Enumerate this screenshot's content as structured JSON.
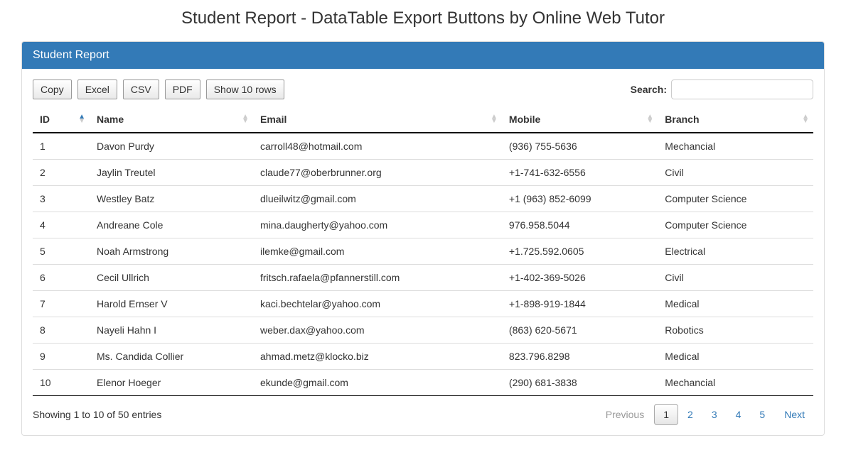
{
  "page_title": "Student Report - DataTable Export Buttons by Online Web Tutor",
  "panel_title": "Student Report",
  "toolbar": {
    "buttons": {
      "copy": "Copy",
      "excel": "Excel",
      "csv": "CSV",
      "pdf": "PDF",
      "show_rows": "Show 10 rows"
    },
    "search_label": "Search:",
    "search_value": ""
  },
  "columns": {
    "id": "ID",
    "name": "Name",
    "email": "Email",
    "mobile": "Mobile",
    "branch": "Branch"
  },
  "rows": [
    {
      "id": "1",
      "name": "Davon Purdy",
      "email": "carroll48@hotmail.com",
      "mobile": "(936) 755-5636",
      "branch": "Mechancial"
    },
    {
      "id": "2",
      "name": "Jaylin Treutel",
      "email": "claude77@oberbrunner.org",
      "mobile": "+1-741-632-6556",
      "branch": "Civil"
    },
    {
      "id": "3",
      "name": "Westley Batz",
      "email": "dlueilwitz@gmail.com",
      "mobile": "+1 (963) 852-6099",
      "branch": "Computer Science"
    },
    {
      "id": "4",
      "name": "Andreane Cole",
      "email": "mina.daugherty@yahoo.com",
      "mobile": "976.958.5044",
      "branch": "Computer Science"
    },
    {
      "id": "5",
      "name": "Noah Armstrong",
      "email": "ilemke@gmail.com",
      "mobile": "+1.725.592.0605",
      "branch": "Electrical"
    },
    {
      "id": "6",
      "name": "Cecil Ullrich",
      "email": "fritsch.rafaela@pfannerstill.com",
      "mobile": "+1-402-369-5026",
      "branch": "Civil"
    },
    {
      "id": "7",
      "name": "Harold Ernser V",
      "email": "kaci.bechtelar@yahoo.com",
      "mobile": "+1-898-919-1844",
      "branch": "Medical"
    },
    {
      "id": "8",
      "name": "Nayeli Hahn I",
      "email": "weber.dax@yahoo.com",
      "mobile": "(863) 620-5671",
      "branch": "Robotics"
    },
    {
      "id": "9",
      "name": "Ms. Candida Collier",
      "email": "ahmad.metz@klocko.biz",
      "mobile": "823.796.8298",
      "branch": "Medical"
    },
    {
      "id": "10",
      "name": "Elenor Hoeger",
      "email": "ekunde@gmail.com",
      "mobile": "(290) 681-3838",
      "branch": "Mechancial"
    }
  ],
  "footer": {
    "info": "Showing 1 to 10 of 50 entries",
    "prev": "Previous",
    "next": "Next",
    "pages": [
      "1",
      "2",
      "3",
      "4",
      "5"
    ],
    "active_page": "1"
  }
}
